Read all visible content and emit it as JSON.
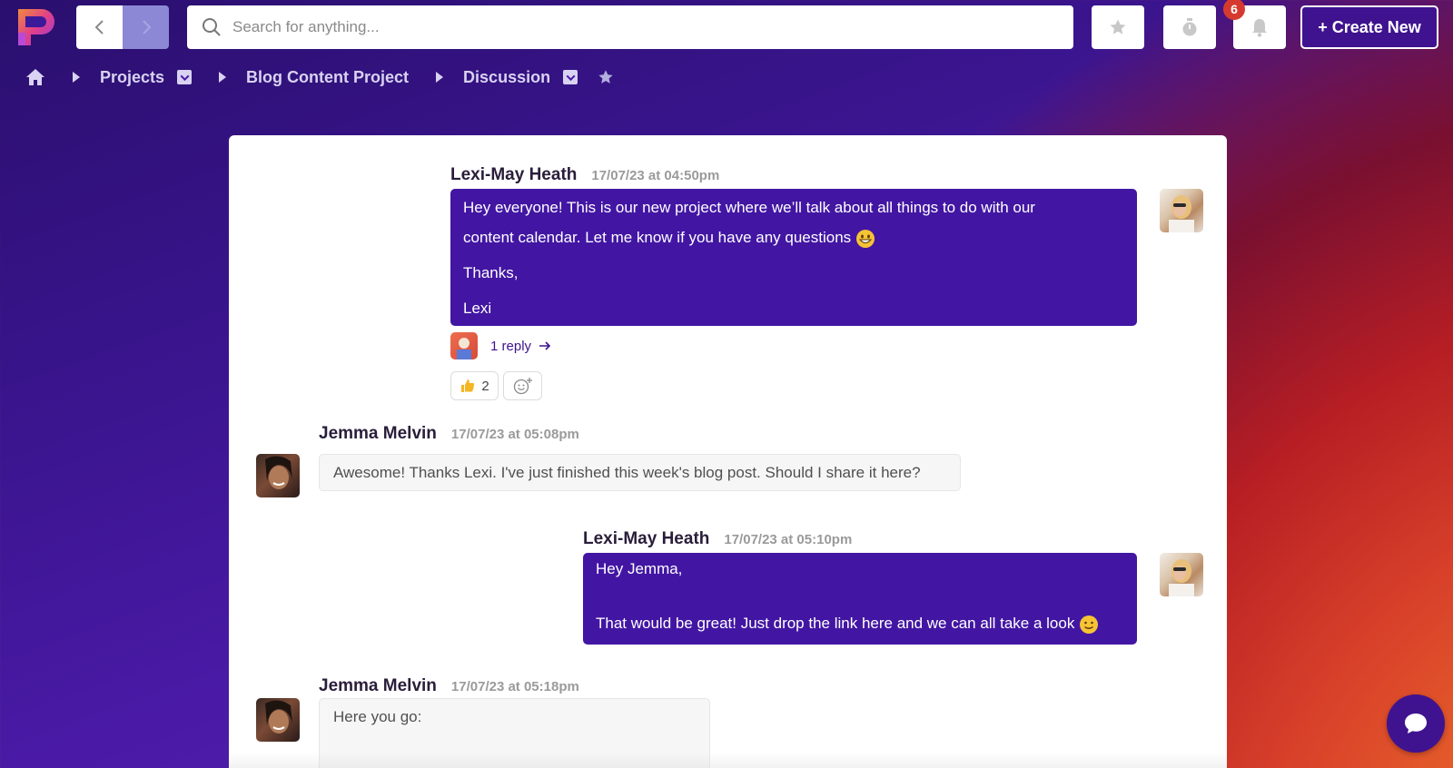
{
  "search": {
    "placeholder": "Search for anything..."
  },
  "topbar": {
    "notification_count": "6",
    "create_label": "+ Create New"
  },
  "breadcrumb": {
    "items": [
      {
        "label": "Projects"
      },
      {
        "label": "Blog Content Project"
      },
      {
        "label": "Discussion"
      }
    ]
  },
  "messages": [
    {
      "author": "Lexi-May Heath",
      "timestamp": "17/07/23 at 04:50pm",
      "lines": [
        "Hey everyone! This is our new project where we’ll talk about all things to do with our",
        "content calendar. Let me know if you have any questions",
        "Thanks,",
        "Lexi"
      ],
      "reply_label": "1 reply",
      "reaction_count": "2"
    },
    {
      "author": "Jemma Melvin",
      "timestamp": "17/07/23 at 05:08pm",
      "text": "Awesome! Thanks Lexi. I've just finished this week's blog post. Should I share it here?"
    },
    {
      "author": "Lexi-May Heath",
      "timestamp": "17/07/23 at 05:10pm",
      "lines": [
        "Hey Jemma,",
        "That would be great! Just drop the link here and we can all take a look"
      ]
    },
    {
      "author": "Jemma Melvin",
      "timestamp": "17/07/23 at 05:18pm",
      "text": "Here you go:"
    }
  ],
  "colors": {
    "accent": "#3f138f",
    "bubble_out": "#4216a3",
    "badge": "#d63a2f"
  }
}
